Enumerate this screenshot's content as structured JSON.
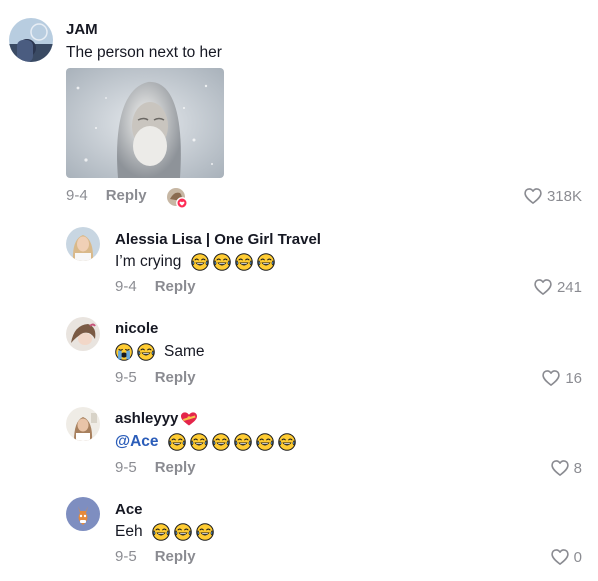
{
  "comments": [
    {
      "username": "JAM",
      "text": "The person next to her",
      "date": "9-4",
      "reply_label": "Reply",
      "likes": "318K",
      "has_image": true,
      "creator_liked": true
    }
  ],
  "replies": [
    {
      "username": "Alessia Lisa | One Girl Travel",
      "text": "I’m crying",
      "emoji_count": 4,
      "date": "9-4",
      "reply_label": "Reply",
      "likes": "241"
    },
    {
      "username": "nicole",
      "text": "Same",
      "leading_emoji": [
        "crying",
        "laughing"
      ],
      "date": "9-5",
      "reply_label": "Reply",
      "likes": "16"
    },
    {
      "username": "ashleyyy",
      "username_suffix_icon": "heart-with-ribbon-icon",
      "mention": "@Ace",
      "emoji_count": 6,
      "date": "9-5",
      "reply_label": "Reply",
      "likes": "8"
    },
    {
      "username": "Ace",
      "text": "Eeh",
      "emoji_count": 3,
      "date": "9-5",
      "reply_label": "Reply",
      "likes": "0"
    }
  ],
  "icons": {
    "like": "heart-outline-icon",
    "emoji_laugh": "face-with-tears-of-joy-icon",
    "emoji_cry": "loudly-crying-face-icon"
  },
  "colors": {
    "secondary_text": "#8a8b91",
    "mention": "#2b5db9",
    "heart_badge": "#fe2c55",
    "emoji_yellow": "#ffcc33"
  }
}
